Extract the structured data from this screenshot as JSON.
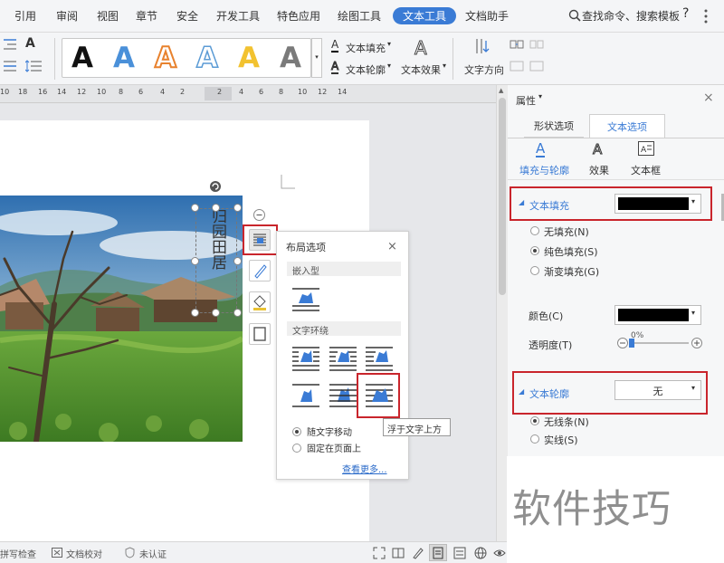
{
  "menubar": {
    "items": [
      "引用",
      "审阅",
      "视图",
      "章节",
      "安全",
      "开发工具",
      "特色应用",
      "绘图工具",
      "文本工具",
      "文档助手"
    ],
    "search": "查找命令、搜索模板",
    "help": "?"
  },
  "ribbon": {
    "text_fill": "文本填充",
    "text_outline": "文本轮廓",
    "text_effect": "文本效果",
    "text_direction": "文字方向",
    "style_letter": "A",
    "style_colors": [
      "#000000",
      "#4a90d9",
      "#e8822e",
      "#5b9bd5",
      "#f2c230",
      "#7a7a7a"
    ]
  },
  "ruler": {
    "numbers": [
      "10",
      "18",
      "16",
      "14",
      "12",
      "10",
      "8",
      "6",
      "4",
      "2",
      "2",
      "4",
      "6",
      "8",
      "10",
      "12",
      "14"
    ]
  },
  "document": {
    "vertical_text": "归园田居"
  },
  "layout_popup": {
    "title": "布局选项",
    "section_inline": "嵌入型",
    "section_wrap": "文字环绕",
    "option_move": "随文字移动",
    "option_fixed": "固定在页面上",
    "more": "查看更多...",
    "tooltip": "浮于文字上方"
  },
  "panel": {
    "title": "属性",
    "tabs": [
      "形状选项",
      "文本选项"
    ],
    "subtabs": [
      "填充与轮廓",
      "效果",
      "文本框"
    ],
    "fill_header": "文本填充",
    "fill_options": [
      "无填充(N)",
      "纯色填充(S)",
      "渐变填充(G)"
    ],
    "color_label": "颜色(C)",
    "transparency_label": "透明度(T)",
    "transparency_value": "0%",
    "outline_header": "文本轮廓",
    "outline_value": "无",
    "outline_options": [
      "无线条(N)",
      "实线(S)"
    ],
    "colors": {
      "fill": "#000000",
      "accent": "#3a7bd5",
      "highlight": "#c9252c"
    }
  },
  "statusbar": {
    "items": [
      "拼写检查",
      "文档校对",
      "未认证"
    ]
  },
  "watermark": "软件技巧"
}
